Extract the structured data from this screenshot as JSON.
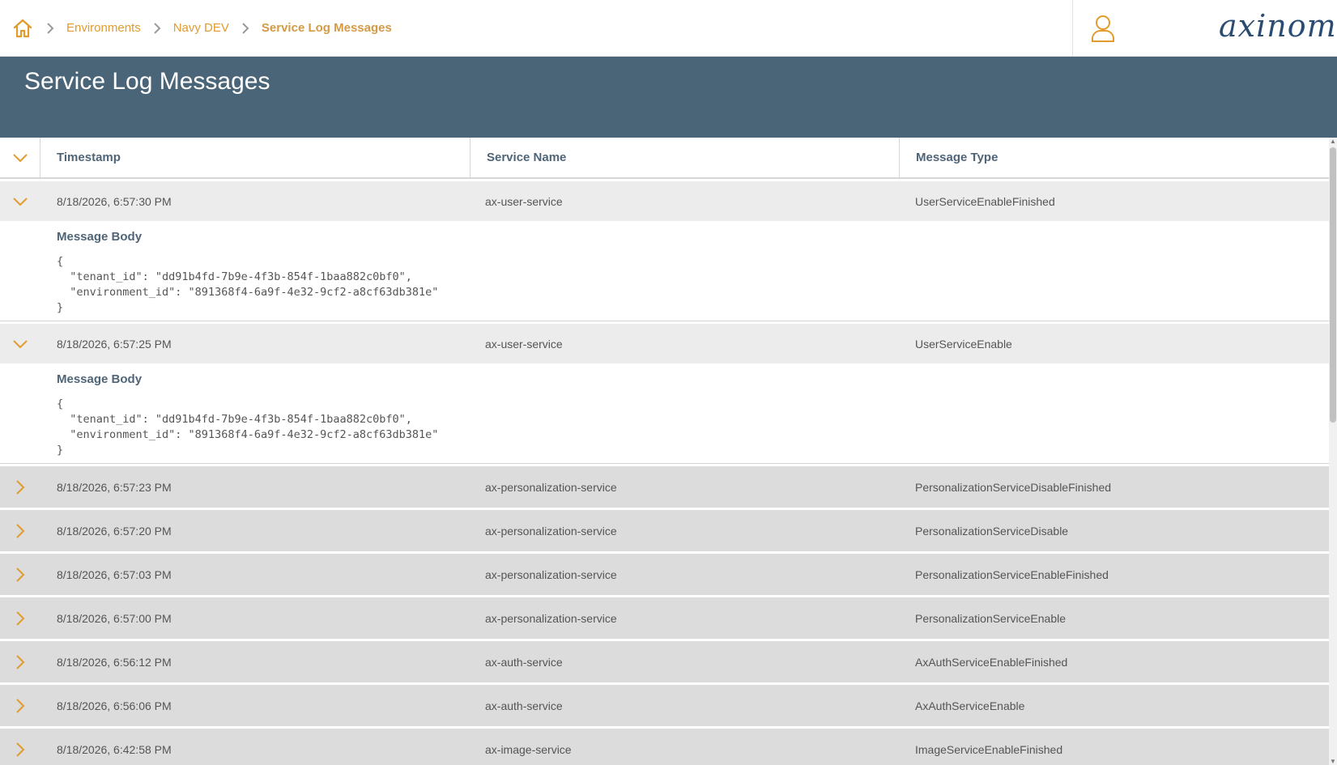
{
  "breadcrumb": {
    "home_icon": "home-icon",
    "items": [
      "Environments",
      "Navy DEV"
    ],
    "current": "Service Log Messages"
  },
  "user_icon": "user-icon",
  "logo": "axinom!",
  "page": {
    "title": "Service Log Messages"
  },
  "colors": {
    "accent": "#e39b2e",
    "header_bg": "#4a6478",
    "logo": "#2a4c72"
  },
  "table": {
    "columns": [
      "Timestamp",
      "Service Name",
      "Message Type"
    ],
    "detail_label": "Message Body",
    "rows": [
      {
        "timestamp": "8/18/2026, 6:57:30 PM",
        "service": "ax-user-service",
        "type": "UserServiceEnableFinished",
        "expanded": true,
        "body": "{\n  \"tenant_id\": \"dd91b4fd-7b9e-4f3b-854f-1baa882c0bf0\",\n  \"environment_id\": \"891368f4-6a9f-4e32-9cf2-a8cf63db381e\"\n}"
      },
      {
        "timestamp": "8/18/2026, 6:57:25 PM",
        "service": "ax-user-service",
        "type": "UserServiceEnable",
        "expanded": true,
        "body": "{\n  \"tenant_id\": \"dd91b4fd-7b9e-4f3b-854f-1baa882c0bf0\",\n  \"environment_id\": \"891368f4-6a9f-4e32-9cf2-a8cf63db381e\"\n}"
      },
      {
        "timestamp": "8/18/2026, 6:57:23 PM",
        "service": "ax-personalization-service",
        "type": "PersonalizationServiceDisableFinished",
        "expanded": false
      },
      {
        "timestamp": "8/18/2026, 6:57:20 PM",
        "service": "ax-personalization-service",
        "type": "PersonalizationServiceDisable",
        "expanded": false
      },
      {
        "timestamp": "8/18/2026, 6:57:03 PM",
        "service": "ax-personalization-service",
        "type": "PersonalizationServiceEnableFinished",
        "expanded": false
      },
      {
        "timestamp": "8/18/2026, 6:57:00 PM",
        "service": "ax-personalization-service",
        "type": "PersonalizationServiceEnable",
        "expanded": false
      },
      {
        "timestamp": "8/18/2026, 6:56:12 PM",
        "service": "ax-auth-service",
        "type": "AxAuthServiceEnableFinished",
        "expanded": false
      },
      {
        "timestamp": "8/18/2026, 6:56:06 PM",
        "service": "ax-auth-service",
        "type": "AxAuthServiceEnable",
        "expanded": false
      },
      {
        "timestamp": "8/18/2026, 6:42:58 PM",
        "service": "ax-image-service",
        "type": "ImageServiceEnableFinished",
        "expanded": false
      }
    ]
  }
}
